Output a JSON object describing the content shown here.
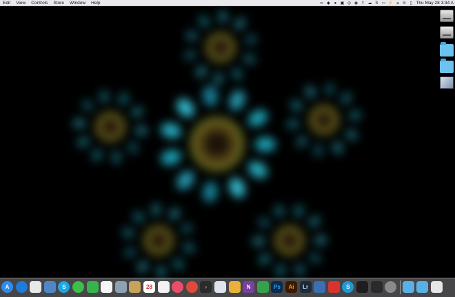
{
  "menubar": {
    "items": [
      "Edit",
      "View",
      "Controls",
      "Store",
      "Window",
      "Help"
    ],
    "clock": "Thu May 28  3:34 A",
    "status_icons": [
      "link-icon",
      "dropbox-icon",
      "evernote-icon",
      "clipboard-icon",
      "sync-icon",
      "creative-cloud-icon",
      "upload-icon",
      "cloud-icon",
      "s-icon",
      "display-icon",
      "battery-icon",
      "volume-icon",
      "wifi-icon",
      "monitor-icon"
    ]
  },
  "desktop": {
    "icons": [
      "hard-drive-icon",
      "external-drive-icon",
      "folder-icon",
      "folder-icon",
      "disk-image-icon"
    ]
  },
  "dock": {
    "apps": [
      {
        "name": "app-store",
        "glyph": "A"
      },
      {
        "name": "safari",
        "glyph": ""
      },
      {
        "name": "preview",
        "glyph": ""
      },
      {
        "name": "rocket",
        "glyph": ""
      },
      {
        "name": "skype",
        "glyph": "S"
      },
      {
        "name": "messages",
        "glyph": ""
      },
      {
        "name": "facetime",
        "glyph": ""
      },
      {
        "name": "scrivener",
        "glyph": "S"
      },
      {
        "name": "migration",
        "glyph": ""
      },
      {
        "name": "notefile",
        "glyph": ""
      },
      {
        "name": "calendar",
        "glyph": "28"
      },
      {
        "name": "photos",
        "glyph": ""
      },
      {
        "name": "itunes",
        "glyph": ""
      },
      {
        "name": "podcast",
        "glyph": ""
      },
      {
        "name": "chevron",
        "glyph": "›"
      },
      {
        "name": "photo-booth",
        "glyph": ""
      },
      {
        "name": "tes",
        "glyph": ""
      },
      {
        "name": "onenote",
        "glyph": "N"
      },
      {
        "name": "numbers",
        "glyph": ""
      },
      {
        "name": "photoshop",
        "glyph": "Ps"
      },
      {
        "name": "illustrator",
        "glyph": "Ai"
      },
      {
        "name": "lightroom",
        "glyph": "Lr"
      },
      {
        "name": "screen-sharing",
        "glyph": ""
      },
      {
        "name": "ultra",
        "glyph": ""
      },
      {
        "name": "slack-s",
        "glyph": "S"
      },
      {
        "name": "terminal",
        "glyph": ""
      },
      {
        "name": "activity-monitor",
        "glyph": ""
      },
      {
        "name": "system-preferences",
        "glyph": ""
      },
      {
        "name": "folder-a",
        "glyph": ""
      },
      {
        "name": "folder-b",
        "glyph": ""
      },
      {
        "name": "trash",
        "glyph": ""
      }
    ]
  }
}
